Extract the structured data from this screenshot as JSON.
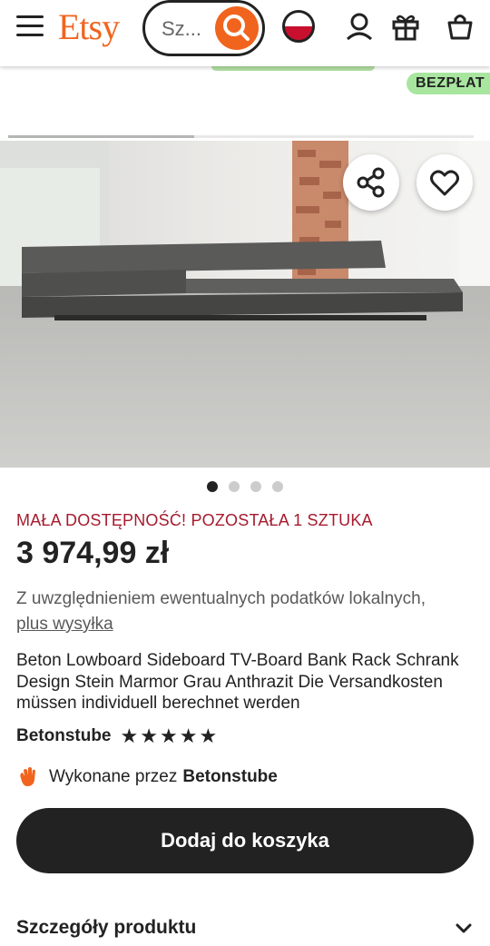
{
  "header": {
    "logo": "Etsy",
    "search_placeholder": "Sz...",
    "icons": [
      "menu-icon",
      "search-icon",
      "flag-icon",
      "account-icon",
      "gift-icon",
      "cart-icon"
    ]
  },
  "banner": {
    "free_badge": "BEZPŁAT"
  },
  "gallery": {
    "image_count": 4,
    "active_index": 0,
    "progress_fraction": 0.4
  },
  "product": {
    "stock_message": "MAŁA DOSTĘPNOŚĆ! POZOSTAŁA 1 SZTUKA",
    "price": "3 974,99 zł",
    "tax_text": "Z uwzględnieniem ewentualnych podatków lokalnych,",
    "shipping_link": "plus wysyłka",
    "title": "Beton Lowboard Sideboard TV-Board Bank Rack Schrank Design Stein Marmor Grau Anthrazit Die Versandkosten müssen individuell berechnet werden",
    "shop_name": "Betonstube",
    "rating": 5,
    "made_by_prefix": "Wykonane przez",
    "made_by_shop": "Betonstube",
    "add_to_cart": "Dodaj do koszyka",
    "details_heading": "Szczegóły produktu"
  },
  "colors": {
    "brand": "#f1641e",
    "stock": "#a61a2e",
    "badge": "#a8e6a0"
  }
}
